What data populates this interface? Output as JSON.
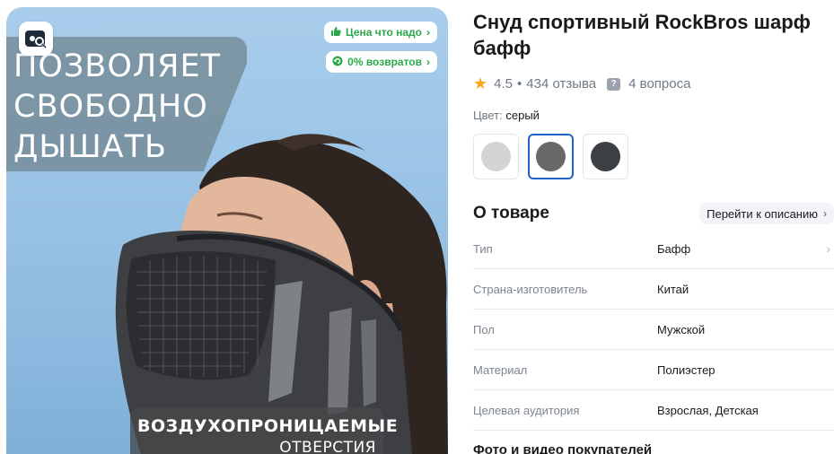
{
  "gallery": {
    "promo_text": "ПОЗВОЛЯЕТ\nСВОБОДНО\nДЫШАТЬ",
    "badges": [
      {
        "label": "Цена что надо",
        "icon": "thumbs-up-icon"
      },
      {
        "label": "0% возвратов",
        "icon": "return-icon"
      }
    ],
    "caption_line1": "ВОЗДУХОПРОНИЦАЕМЫЕ",
    "caption_line2": "ОТВЕРСТИЯ"
  },
  "product": {
    "title": "Снуд спортивный RockBros шарф бафф",
    "rating": "4.5",
    "separator": "•",
    "reviews": "434 отзыва",
    "questions": "4 вопроса",
    "color_label": "Цвет:",
    "color_value": "серый",
    "swatches": [
      {
        "color": "#d4d4d4",
        "active": false
      },
      {
        "color": "#686868",
        "active": true
      },
      {
        "color": "#3c3f44",
        "active": false
      }
    ]
  },
  "about": {
    "title": "О товаре",
    "goto_label": "Перейти к описанию",
    "specs": [
      {
        "key": "Тип",
        "value": "Бафф"
      },
      {
        "key": "Страна-изготовитель",
        "value": "Китай"
      },
      {
        "key": "Пол",
        "value": "Мужской"
      },
      {
        "key": "Материал",
        "value": "Полиэстер"
      },
      {
        "key": "Целевая аудитория",
        "value": "Взрослая, Детская"
      }
    ]
  },
  "reviews_section": {
    "title": "Фото и видео покупателей"
  },
  "colors": {
    "accent": "#1e64c8",
    "badge_green": "#2aa84a",
    "star": "#f6a71a"
  }
}
